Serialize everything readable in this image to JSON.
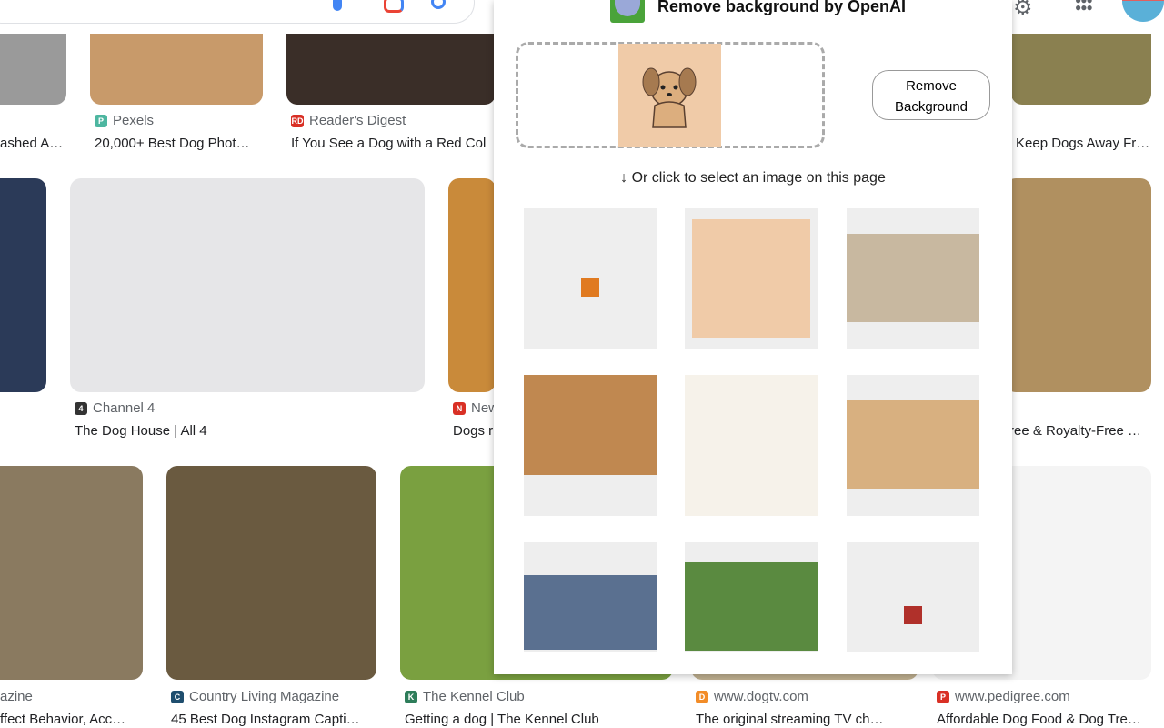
{
  "google": {
    "icons": [
      "mic-icon",
      "lens-icon",
      "search-icon",
      "settings-icon",
      "apps-icon",
      "avatar"
    ],
    "results": [
      {
        "source": "",
        "title": "ashed A…",
        "color": "#9a9a9a"
      },
      {
        "source": "Pexels",
        "title": "20,000+ Best Dog Phot…",
        "color": "#c89a6a",
        "fav": "#4db6a0",
        "favtext": "P"
      },
      {
        "source": "Reader's Digest",
        "title": "If You See a Dog with a Red Col",
        "color": "#3a2e28",
        "fav": "#d93025",
        "favtext": "RD"
      },
      {
        "source": "",
        "title": "Keep Dogs Away Fr…",
        "color": "#8a8050"
      },
      {
        "source": "",
        "title": "",
        "color": "#2b3a58"
      },
      {
        "source": "Channel 4",
        "title": "The Dog House | All 4",
        "color": "#e6e6e8",
        "fav": "#333",
        "favtext": "4"
      },
      {
        "source": "New",
        "title": "Dogs r",
        "color": "#c98a3a",
        "fav": "#d93025",
        "favtext": "N"
      },
      {
        "source": "",
        "title": "ree & Royalty-Free …",
        "color": "#b09060"
      },
      {
        "source": "azine",
        "title": "ffect Behavior, Acc…",
        "color": "#8a7a60"
      },
      {
        "source": "Country Living Magazine",
        "title": "45 Best Dog Instagram Capti…",
        "color": "#6a5a40",
        "fav": "#1f4e6e",
        "favtext": "C"
      },
      {
        "source": "The Kennel Club",
        "title": "Getting a dog | The Kennel Club",
        "color": "#7aa040",
        "fav": "#2e7d5a",
        "favtext": "K"
      },
      {
        "source": "www.dogtv.com",
        "title": "The original streaming TV ch…",
        "color": "#c0b090",
        "fav": "#f28c28",
        "favtext": "D"
      },
      {
        "source": "www.pedigree.com",
        "title": "Affordable Dog Food & Dog Tre…",
        "color": "#f4f4f4",
        "fav": "#d93025",
        "favtext": "P"
      }
    ]
  },
  "popup": {
    "title": "Remove background by OpenAI",
    "remove_button": "Remove Background",
    "hint": "↓ Or click to select an image on this page",
    "images": [
      {
        "name": "small-logo",
        "color": "#e07a20"
      },
      {
        "name": "cartoon-puppy",
        "color": "#f0cba8"
      },
      {
        "name": "dog-eating",
        "color": "#c8b8a0"
      },
      {
        "name": "golden-retriever",
        "color": "#c08850"
      },
      {
        "name": "two-puppies",
        "color": "#f6f2ea"
      },
      {
        "name": "retriever-puppies",
        "color": "#d8b080"
      },
      {
        "name": "man-with-dog",
        "color": "#5a7090"
      },
      {
        "name": "shar-pei",
        "color": "#5a8a40"
      },
      {
        "name": "sl-logo",
        "color": "#b0302a"
      }
    ]
  }
}
